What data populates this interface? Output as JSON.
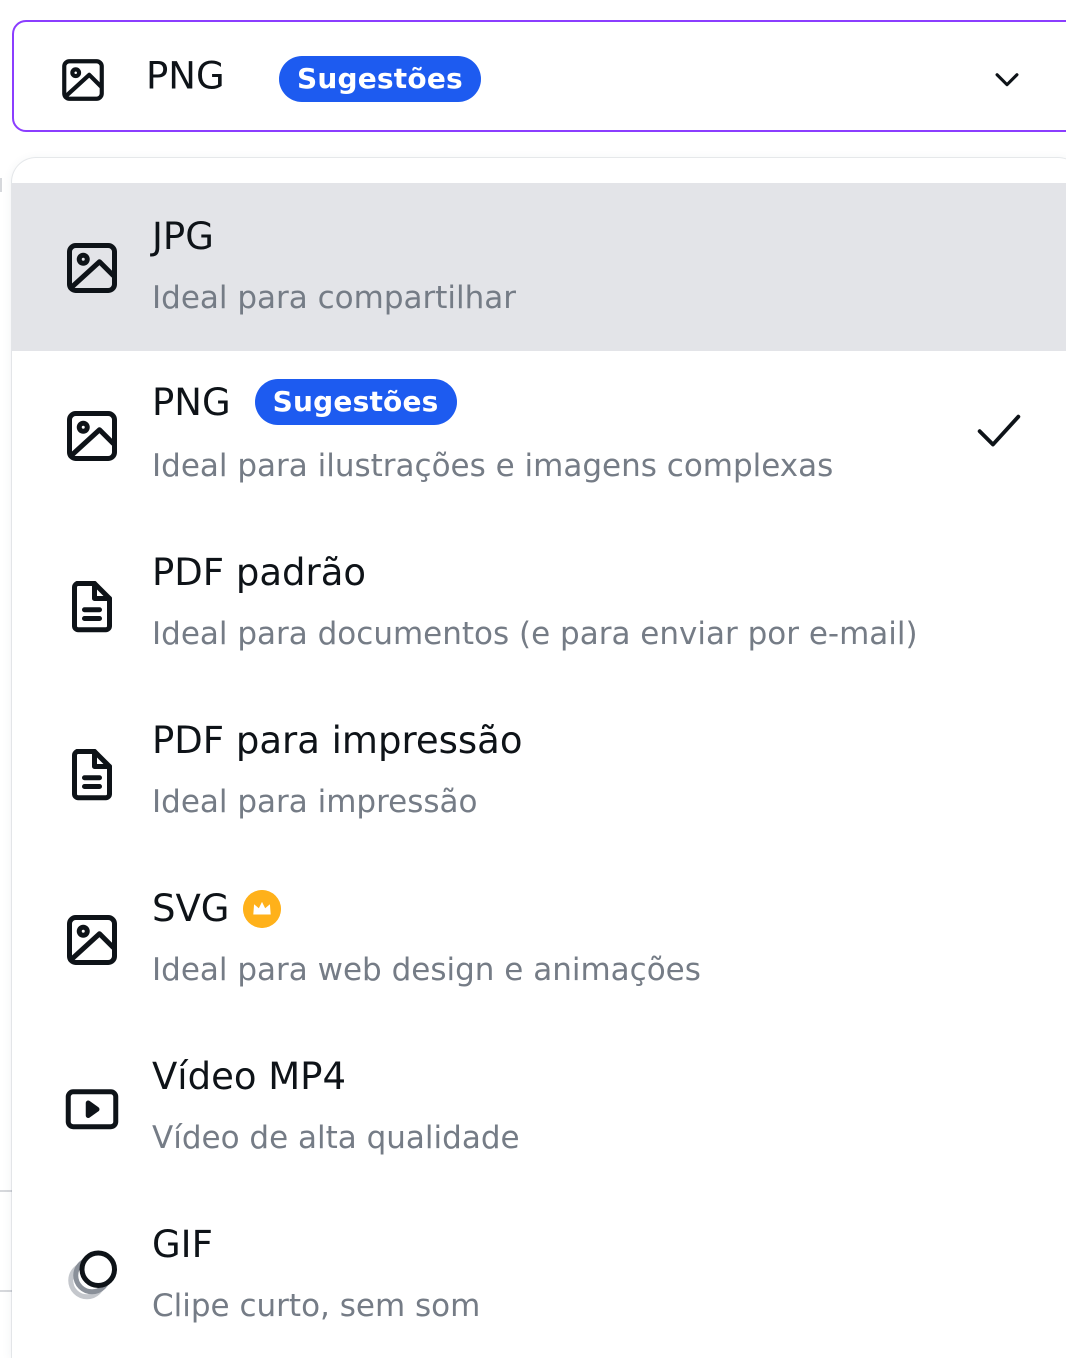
{
  "select": {
    "value": "PNG",
    "badge": "Sugestões",
    "icon": "image-icon",
    "chevron_icon": "chevron-down-icon"
  },
  "menu": {
    "items": [
      {
        "title": "JPG",
        "description": "Ideal para compartilhar",
        "icon": "image-icon",
        "highlighted": true
      },
      {
        "title": "PNG",
        "badge": "Sugestões",
        "description": "Ideal para ilustrações e imagens complexas",
        "icon": "image-icon",
        "selected": true
      },
      {
        "title": "PDF padrão",
        "description": "Ideal para documentos (e para enviar por e-mail)",
        "icon": "document-icon"
      },
      {
        "title": "PDF para impressão",
        "description": "Ideal para impressão",
        "icon": "document-icon"
      },
      {
        "title": "SVG",
        "premium": true,
        "description": "Ideal para web design e animações",
        "icon": "image-icon"
      },
      {
        "title": "Vídeo MP4",
        "description": "Vídeo de alta qualidade",
        "icon": "video-icon"
      },
      {
        "title": "GIF",
        "description": "Clipe curto, sem som",
        "icon": "gif-icon"
      }
    ]
  },
  "colors": {
    "accent_border": "#8b3dff",
    "badge_blue": "#1d5bf0",
    "highlight_bg": "#e3e4e8",
    "premium_crown": "#ffb11a",
    "description_text": "#757c86"
  }
}
